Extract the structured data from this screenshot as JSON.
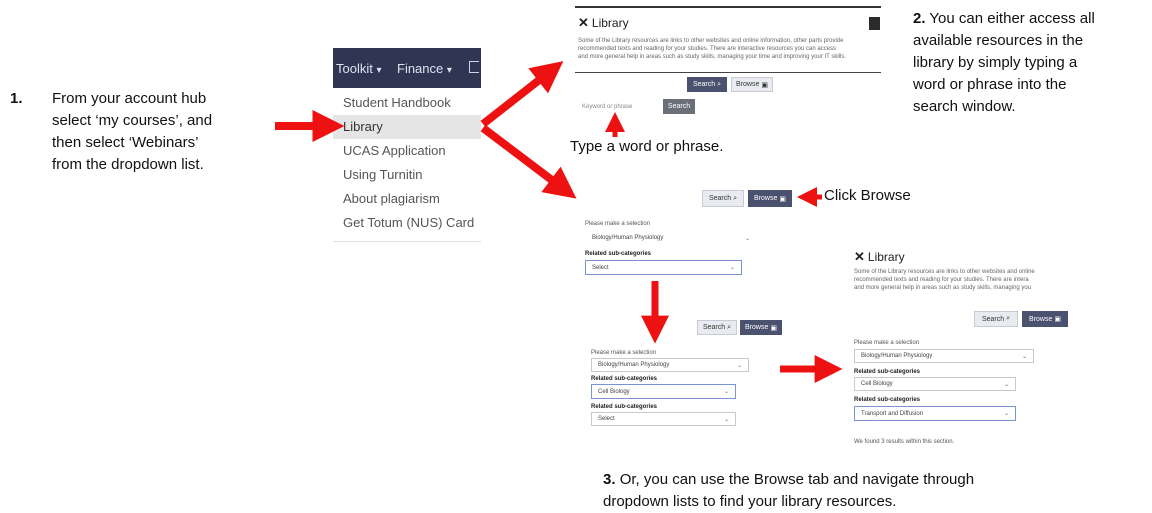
{
  "step1": {
    "number": "1.",
    "lines": [
      "From your account hub",
      "select ‘my courses’, and",
      "then select ‘Webinars’",
      "from the dropdown list."
    ]
  },
  "nav": {
    "toolkit": "Toolkit",
    "finance": "Finance",
    "caret": "▾",
    "menu": [
      "Student Handbook",
      "Library",
      "UCAS Application",
      "Using Turnitin",
      "About plagiarism",
      "Get Totum (NUS) Card"
    ]
  },
  "library_top": {
    "title": "Library",
    "desc": [
      "Some of the Library resources are links to other websites and online information, other parts provide",
      "recommended texts and reading for your studies. There are interactive resources you can access",
      "and more general help in areas such as study skills, managing your time and improving your IT skills."
    ],
    "search_tab": "Search",
    "browse_tab": "Browse",
    "keyword_placeholder": "Keyword or phrase",
    "search_button": "Search"
  },
  "annotations": {
    "type_word": "Type a word or phrase.",
    "click_browse": "Click Browse"
  },
  "step2": {
    "number": "2.",
    "lines": [
      "You can either access all",
      "available resources in the",
      "library by simply typing a",
      "word or phrase into the",
      "search window."
    ]
  },
  "browse1": {
    "search_tab": "Search",
    "browse_tab": "Browse",
    "make_selection": "Please make a selection",
    "selection_value": "Biology/Human Physiology",
    "related": "Related sub-categories",
    "sub_value": "Select"
  },
  "browse2": {
    "search_tab": "Search",
    "browse_tab": "Browse",
    "make_selection": "Please make a selection",
    "selection_value": "Biology/Human Physiology",
    "related1": "Related sub-categories",
    "sub1_value": "Cell Biology",
    "related2": "Related sub-categories",
    "sub2_value": "Select"
  },
  "library_right": {
    "title": "Library",
    "desc": [
      "Some of the Library resources are links to other websites and online",
      "recommended texts and reading for your studies. There are intera",
      "and more general help in areas such as study skills, managing you"
    ],
    "search_tab": "Search",
    "browse_tab": "Browse",
    "make_selection": "Please make a selection",
    "selection_value": "Biology/Human Physiology",
    "related1": "Related sub-categories",
    "sub1_value": "Cell Biology",
    "related2": "Related sub-categories",
    "sub2_value": "Transport and Diffusion",
    "result_text": "We found 3 results within this section."
  },
  "step3": {
    "number": "3.",
    "line1": "Or, you can use the Browse tab and navigate through",
    "line2": "dropdown lists to find your library resources."
  },
  "colors": {
    "arrow": "#ee1111",
    "navbar": "#2f3553",
    "button_dark": "#4b5270"
  }
}
